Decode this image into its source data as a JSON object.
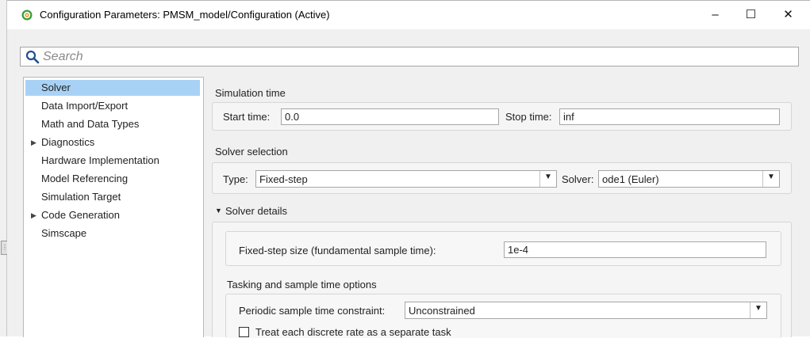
{
  "window": {
    "title": "Configuration Parameters: PMSM_model/Configuration (Active)",
    "controls": {
      "minimize": "–",
      "maximize": "☐",
      "close": "✕"
    },
    "icon": "gear-cog-green-icon"
  },
  "search": {
    "placeholder": "Search",
    "value": ""
  },
  "sidebar": {
    "items": [
      {
        "label": "Solver",
        "selected": true,
        "expandable": false
      },
      {
        "label": "Data Import/Export",
        "selected": false,
        "expandable": false
      },
      {
        "label": "Math and Data Types",
        "selected": false,
        "expandable": false
      },
      {
        "label": "Diagnostics",
        "selected": false,
        "expandable": true
      },
      {
        "label": "Hardware Implementation",
        "selected": false,
        "expandable": false
      },
      {
        "label": "Model Referencing",
        "selected": false,
        "expandable": false
      },
      {
        "label": "Simulation Target",
        "selected": false,
        "expandable": false
      },
      {
        "label": "Code Generation",
        "selected": false,
        "expandable": true
      },
      {
        "label": "Simscape",
        "selected": false,
        "expandable": false
      }
    ],
    "expand_glyph": "▶"
  },
  "main": {
    "simulation_time": {
      "title": "Simulation time",
      "start_label": "Start time:",
      "start_value": "0.0",
      "stop_label": "Stop time:",
      "stop_value": "inf"
    },
    "solver_selection": {
      "title": "Solver selection",
      "type_label": "Type:",
      "type_value": "Fixed-step",
      "solver_label": "Solver:",
      "solver_value": "ode1 (Euler)"
    },
    "solver_details": {
      "title": "Solver details",
      "collapse_glyph": "▼",
      "step_size_label": "Fixed-step size (fundamental sample time):",
      "step_size_value": "1e-4",
      "tasking": {
        "title": "Tasking and sample time options",
        "constraint_label": "Periodic sample time constraint:",
        "constraint_value": "Unconstrained",
        "treat_discrete_label": "Treat each discrete rate as a separate task",
        "treat_discrete_checked": false
      }
    },
    "dropdown_glyph": "▼"
  },
  "colors": {
    "selection": "#a8d2f5",
    "window_bg": "#f0f0f0",
    "group_bg": "#f5f5f5",
    "border": "#a6a6a6",
    "icon_accent": "#3f9b3f"
  }
}
